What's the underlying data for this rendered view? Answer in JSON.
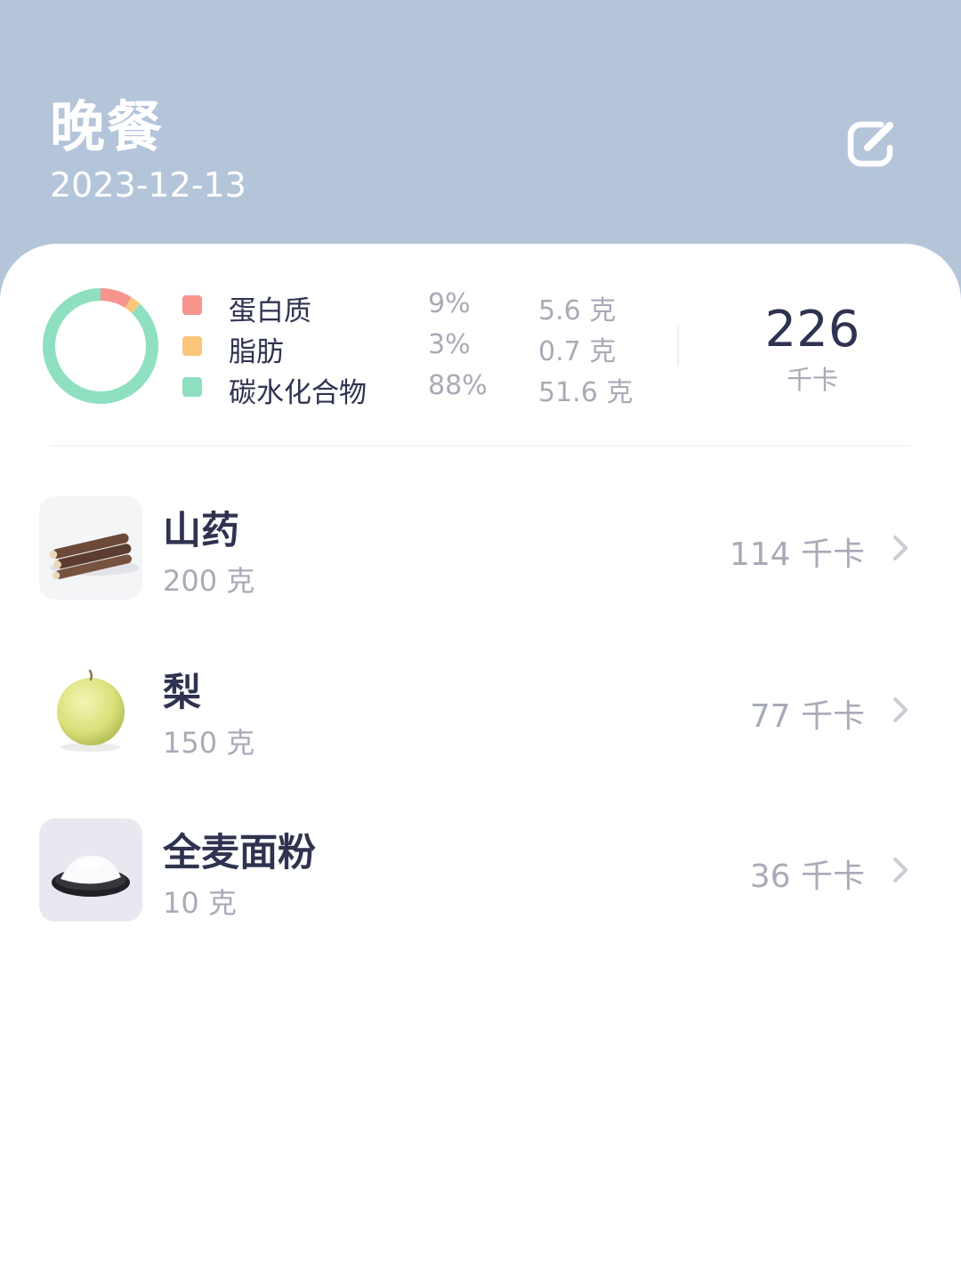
{
  "header": {
    "title": "晚餐",
    "date": "2023-12-13",
    "edit_icon": "edit-icon",
    "background": "#b4c5da"
  },
  "summary": {
    "macros": [
      {
        "name": "蛋白质",
        "percent": "9%",
        "amount": "5.6 克",
        "color": "#f7948e",
        "fraction": 0.09
      },
      {
        "name": "脂肪",
        "percent": "3%",
        "amount": "0.7 克",
        "color": "#fbc57a",
        "fraction": 0.03
      },
      {
        "name": "碳水化合物",
        "percent": "88%",
        "amount": "51.6 克",
        "color": "#8ee0c0",
        "fraction": 0.88
      }
    ],
    "total_kcal": "226",
    "total_unit": "千卡"
  },
  "foods": [
    {
      "name": "山药",
      "amount": "200 克",
      "kcal": "114 千卡",
      "icon": "chinese-yam-image"
    },
    {
      "name": "梨",
      "amount": "150 克",
      "kcal": "77 千卡",
      "icon": "pear-image"
    },
    {
      "name": "全麦面粉",
      "amount": "10 克",
      "kcal": "36 千卡",
      "icon": "whole-wheat-flour-image"
    }
  ]
}
